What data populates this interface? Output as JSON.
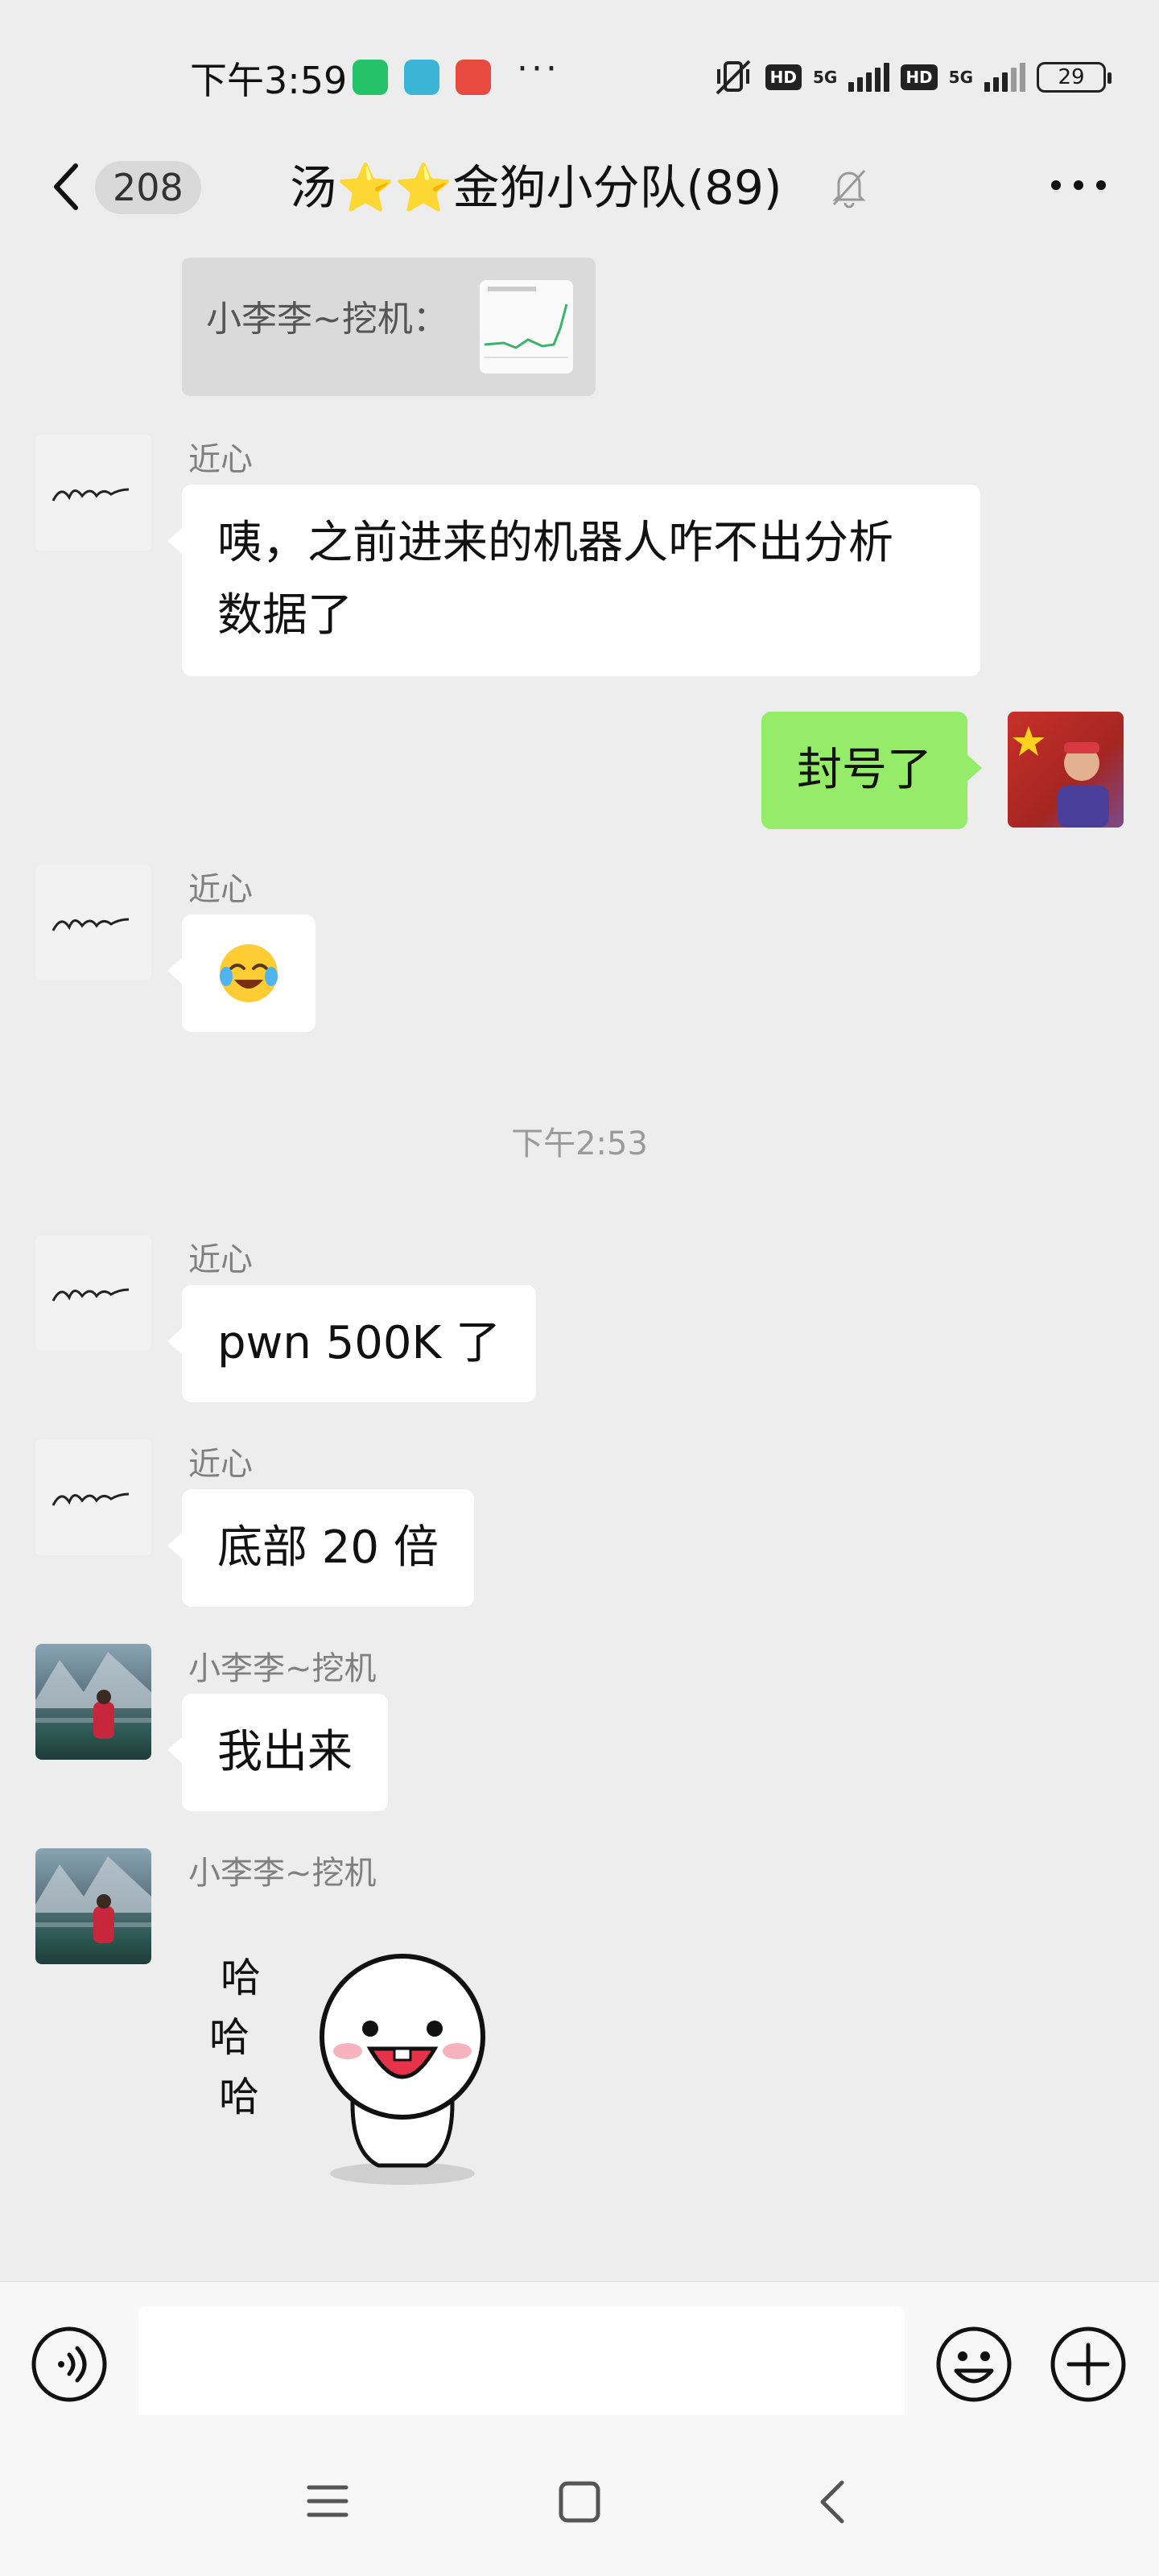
{
  "status_bar": {
    "time": "下午3:59",
    "more": "···",
    "hd1": "HD",
    "net1": "5G",
    "hd2": "HD",
    "net2": "5G",
    "battery": "29"
  },
  "header": {
    "unread_count": "208",
    "title_prefix": "汤",
    "title_stars": "⭐⭐",
    "title_suffix": "金狗小分队(89)",
    "muted": true
  },
  "messages": {
    "quote": {
      "text": "小李李~挖机："
    },
    "m1": {
      "sender": "近心",
      "text_line1": "咦，之前进来的机器人咋不出分析",
      "text_line2": "数据了"
    },
    "m2": {
      "text": "封号了"
    },
    "m3": {
      "sender": "近心",
      "emoji": "face-with-tears-of-joy"
    },
    "timestamp": "下午2:53",
    "m4": {
      "sender": "近心",
      "text": "pwn 500K 了"
    },
    "m5": {
      "sender": "近心",
      "text": "底部 20 倍"
    },
    "m6": {
      "sender": "小李李~挖机",
      "text": "我出来"
    },
    "m7": {
      "sender": "小李李~挖机",
      "sticker_text": [
        "哈",
        "哈",
        "哈"
      ]
    }
  },
  "input": {
    "value": "",
    "placeholder": ""
  },
  "colors": {
    "background": "#ededed",
    "outgoing_bubble": "#95ec69",
    "incoming_bubble": "#ffffff",
    "star": "#f6b800"
  }
}
